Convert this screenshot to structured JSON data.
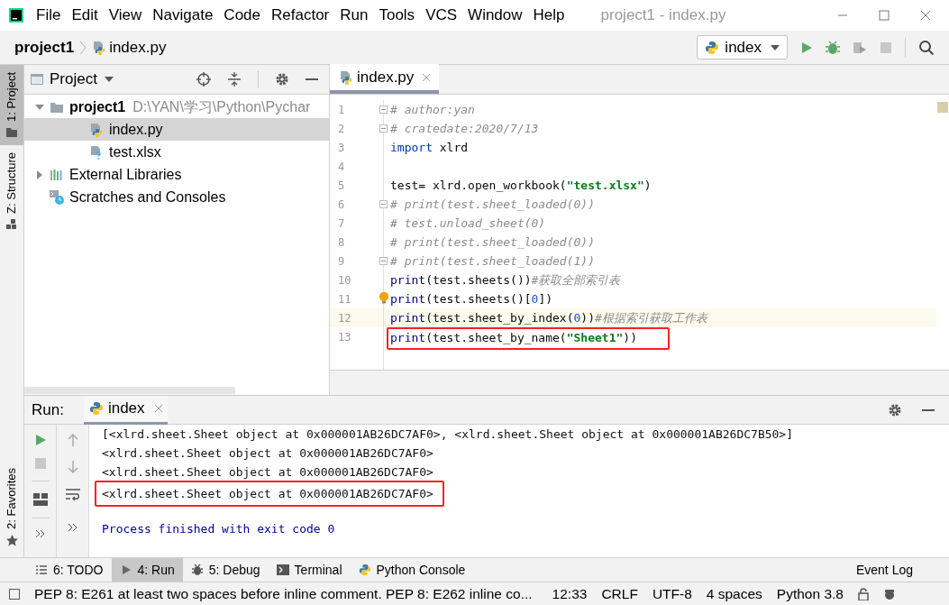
{
  "menu": [
    "File",
    "Edit",
    "View",
    "Navigate",
    "Code",
    "Refactor",
    "Run",
    "Tools",
    "VCS",
    "Window",
    "Help"
  ],
  "window_title": "project1 - index.py",
  "breadcrumbs": [
    {
      "text": "project1",
      "kind": "project"
    },
    {
      "text": "index.py",
      "kind": "python-file"
    }
  ],
  "run_config": "index",
  "left_stripe": [
    {
      "label": "1: Project",
      "kind": "folder",
      "selected": true
    },
    {
      "label": "Z: Structure",
      "kind": "structure",
      "selected": false
    }
  ],
  "favorites_stripe": {
    "label": "2: Favorites"
  },
  "project_panel": {
    "title": "Project",
    "tree": [
      {
        "name": "project1",
        "path": "D:\\YAN\\学习\\Python\\Pychar",
        "kind": "folder",
        "expanded": true,
        "selected": false,
        "children": [
          {
            "name": "index.py",
            "kind": "python-file",
            "selected": true
          },
          {
            "name": "test.xlsx",
            "kind": "unknown-file",
            "selected": false
          }
        ]
      },
      {
        "name": "External Libraries",
        "kind": "libraries",
        "expanded": false,
        "selected": false
      },
      {
        "name": "Scratches and Consoles",
        "kind": "scratches",
        "selected": false
      }
    ]
  },
  "editor": {
    "tabs": [
      {
        "label": "index.py",
        "selected": true
      }
    ],
    "lines": [
      {
        "number": "1",
        "fold": true,
        "current": false,
        "bulb": false,
        "boxed": false,
        "tokens": [
          {
            "kind": "comment",
            "text": "# author:yan"
          }
        ]
      },
      {
        "number": "2",
        "fold": true,
        "current": false,
        "bulb": false,
        "boxed": false,
        "tokens": [
          {
            "kind": "comment",
            "text": "# cratedate:2020/7/13"
          }
        ]
      },
      {
        "number": "3",
        "fold": false,
        "current": false,
        "bulb": false,
        "boxed": false,
        "tokens": [
          {
            "kind": "keyword",
            "text": "import"
          },
          {
            "kind": "plain",
            "text": " xlrd"
          }
        ]
      },
      {
        "number": "4",
        "fold": false,
        "current": false,
        "bulb": false,
        "boxed": false
      },
      {
        "number": "5",
        "fold": false,
        "current": false,
        "bulb": false,
        "boxed": false,
        "tokens": [
          {
            "kind": "plain",
            "text": "test= xlrd.open_workbook("
          },
          {
            "kind": "string",
            "text": "\"test.xlsx\""
          },
          {
            "kind": "plain",
            "text": ")"
          }
        ]
      },
      {
        "number": "6",
        "fold": true,
        "current": false,
        "bulb": false,
        "boxed": false,
        "tokens": [
          {
            "kind": "comment",
            "text": "# print(test.sheet_loaded(0))"
          }
        ]
      },
      {
        "number": "7",
        "fold": false,
        "current": false,
        "bulb": false,
        "boxed": false,
        "tokens": [
          {
            "kind": "comment",
            "text": "# test.unload_sheet(0)"
          }
        ]
      },
      {
        "number": "8",
        "fold": false,
        "current": false,
        "bulb": false,
        "boxed": false,
        "tokens": [
          {
            "kind": "comment",
            "text": "# print(test.sheet_loaded(0))"
          }
        ]
      },
      {
        "number": "9",
        "fold": true,
        "current": false,
        "bulb": false,
        "boxed": false,
        "tokens": [
          {
            "kind": "comment",
            "text": "# print(test.sheet_loaded(1))"
          }
        ]
      },
      {
        "number": "10",
        "fold": false,
        "current": false,
        "bulb": false,
        "boxed": false,
        "tokens": [
          {
            "kind": "builtin",
            "text": "print"
          },
          {
            "kind": "plain",
            "text": "(test.sheets())"
          },
          {
            "kind": "comment",
            "text": "#获取全部索引表"
          }
        ]
      },
      {
        "number": "11",
        "fold": false,
        "current": false,
        "bulb": true,
        "boxed": false,
        "tokens": [
          {
            "kind": "builtin",
            "text": "print"
          },
          {
            "kind": "plain",
            "text": "(test.sheets()["
          },
          {
            "kind": "number",
            "text": "0"
          },
          {
            "kind": "plain",
            "text": "])"
          }
        ]
      },
      {
        "number": "12",
        "fold": false,
        "current": true,
        "bulb": false,
        "boxed": false,
        "tokens": [
          {
            "kind": "builtin",
            "text": "print"
          },
          {
            "kind": "plain",
            "text": "(test.sheet_by_index("
          },
          {
            "kind": "number",
            "text": "0"
          },
          {
            "kind": "plain",
            "text": "))"
          },
          {
            "kind": "comment",
            "text": "#根据索引获取工作表"
          }
        ]
      },
      {
        "number": "13",
        "fold": false,
        "current": false,
        "bulb": false,
        "boxed": true,
        "tokens": [
          {
            "kind": "builtin",
            "text": "print"
          },
          {
            "kind": "plain",
            "text": "(test.sheet_by_name("
          },
          {
            "kind": "string",
            "text": "\"Sheet1\""
          },
          {
            "kind": "plain",
            "text": "))"
          }
        ]
      }
    ]
  },
  "run_panel": {
    "label": "Run:",
    "tabs": [
      {
        "label": "index",
        "selected": true
      }
    ],
    "output": [
      {
        "kind": "stdout",
        "boxed": false,
        "text": "[<xlrd.sheet.Sheet object at 0x000001AB26DC7AF0>, <xlrd.sheet.Sheet object at 0x000001AB26DC7B50>]"
      },
      {
        "kind": "stdout",
        "boxed": false,
        "text": "<xlrd.sheet.Sheet object at 0x000001AB26DC7AF0>"
      },
      {
        "kind": "stdout",
        "boxed": false,
        "text": "<xlrd.sheet.Sheet object at 0x000001AB26DC7AF0>"
      },
      {
        "kind": "stdout",
        "boxed": true,
        "text": "<xlrd.sheet.Sheet object at 0x000001AB26DC7AF0>"
      },
      {
        "kind": "exit",
        "boxed": false,
        "text": "Process finished with exit code 0"
      }
    ]
  },
  "tool_tabs": [
    {
      "label": "6: TODO",
      "kind": "todo",
      "selected": false
    },
    {
      "label": "4: Run",
      "kind": "run",
      "selected": true
    },
    {
      "label": "5: Debug",
      "kind": "debug",
      "selected": false
    },
    {
      "label": "Terminal",
      "kind": "terminal",
      "selected": false
    },
    {
      "label": "Python Console",
      "kind": "console",
      "selected": false
    }
  ],
  "event_log": "Event Log",
  "status_bar": {
    "message": "PEP 8: E261 at least two spaces before inline comment. PEP 8: E262 inline co...",
    "items": [
      "12:33",
      "CRLF",
      "UTF-8",
      "4 spaces",
      "Python 3.8"
    ]
  }
}
